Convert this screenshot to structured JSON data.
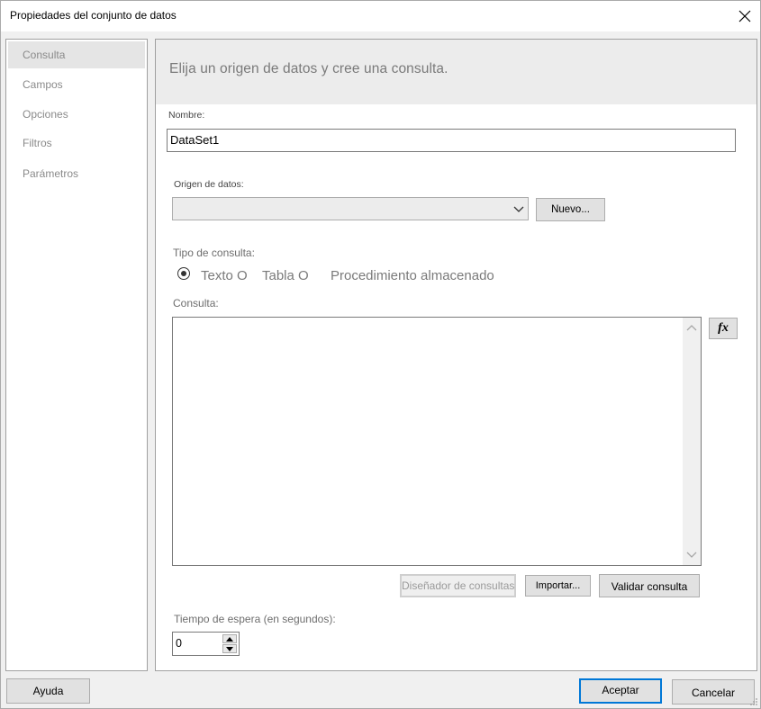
{
  "window": {
    "title": "Propiedades del conjunto de datos"
  },
  "nav": {
    "items": [
      {
        "label": "Consulta",
        "selected": true
      },
      {
        "label": "Campos",
        "selected": false
      },
      {
        "label": "Opciones",
        "selected": false
      },
      {
        "label": "Filtros",
        "selected": false
      },
      {
        "label": "Parámetros",
        "selected": false
      }
    ]
  },
  "panel": {
    "header": "Elija un origen de datos y cree una consulta.",
    "name_label": "Nombre:",
    "name_value": "DataSet1",
    "datasource_label": "Origen de datos:",
    "datasource_value": "",
    "new_button": "Nuevo...",
    "query_type_label": "Tipo de consulta:",
    "query_type_options": [
      "Texto O",
      "Tabla O",
      "Procedimiento almacenado"
    ],
    "query_type_selected": "Texto",
    "query_label": "Consulta:",
    "query_value": "",
    "fx_button": "fx",
    "designer_button": "Diseñador de consultas...",
    "import_button": "Importar...",
    "validate_button": "Validar consulta",
    "timeout_label": "Tiempo de espera (en segundos):",
    "timeout_value": "0"
  },
  "footer": {
    "help": "Ayuda",
    "ok": "Aceptar",
    "cancel": "Cancelar"
  },
  "colors": {
    "accent": "#0078d7",
    "header_bg": "#ececec",
    "muted_text": "#7a7a7a"
  }
}
